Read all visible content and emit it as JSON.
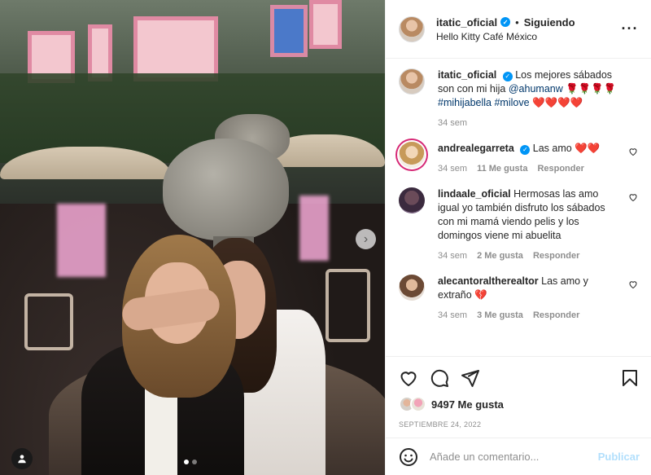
{
  "header": {
    "username": "itatic_oficial",
    "separator": "•",
    "follow_status": "Siguiendo",
    "location": "Hello Kitty Café México",
    "more_icon": "more-horizontal-icon"
  },
  "caption": {
    "username": "itatic_oficial",
    "text_before_mention": "Los mejores sábados son con mi hija ",
    "mention": "@ahumanw",
    "emojis_1": " 🌹🌹🌹🌹",
    "hashtags": "#mihijabella #milove",
    "emojis_2": " ❤️❤️❤️❤️",
    "time": "34 sem"
  },
  "comments": [
    {
      "username": "andrealegarreta",
      "verified": true,
      "text": "Las amo ❤️❤️",
      "time": "34 sem",
      "likes": "11 Me gusta",
      "reply": "Responder"
    },
    {
      "username": "lindaale_oficial",
      "verified": false,
      "text": "Hermosas las amo igual yo también disfruto los sábados con mi mamá viendo pelis y los domingos viene mi abuelita",
      "time": "34 sem",
      "likes": "2 Me gusta",
      "reply": "Responder"
    },
    {
      "username": "alecantoraltherealtor",
      "verified": false,
      "text": "Las amo y extraño 💔",
      "time": "34 sem",
      "likes": "3 Me gusta",
      "reply": "Responder"
    }
  ],
  "actions": {
    "like_icon": "heart-outline-icon",
    "comment_icon": "comment-bubble-icon",
    "share_icon": "paper-plane-icon",
    "save_icon": "bookmark-icon"
  },
  "likes": {
    "count": "9497 Me gusta"
  },
  "date": "Septiembre 24, 2022",
  "composer": {
    "emoji_icon": "smiley-icon",
    "placeholder": "Añade un comentario...",
    "publish_label": "Publicar"
  },
  "media": {
    "next_icon": "chevron-right-icon",
    "next_glyph": "›",
    "carousel_total": 2,
    "carousel_index": 1,
    "tag_icon": "user-tag-icon"
  },
  "colors": {
    "verified": "#0095f6",
    "link": "#00376b",
    "muted": "#8e8e8e",
    "publish_disabled": "#b2dffc"
  }
}
